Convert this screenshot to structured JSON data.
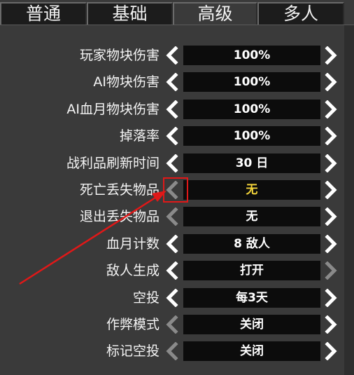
{
  "tabs": [
    {
      "label": "普通",
      "active": false
    },
    {
      "label": "基础",
      "active": false
    },
    {
      "label": "高级",
      "active": true
    },
    {
      "label": "多人",
      "active": false
    }
  ],
  "settings": [
    {
      "label": "玩家物块伤害",
      "value": "100%",
      "left_enabled": true,
      "right_enabled": true
    },
    {
      "label": "AI物块伤害",
      "value": "100%",
      "left_enabled": true,
      "right_enabled": true
    },
    {
      "label": "AI血月物块伤害",
      "value": "100%",
      "left_enabled": true,
      "right_enabled": true
    },
    {
      "label": "掉落率",
      "value": "100%",
      "left_enabled": true,
      "right_enabled": true
    },
    {
      "label": "战利品刷新时间",
      "value": "30 日",
      "left_enabled": true,
      "right_enabled": true
    },
    {
      "label": "死亡丢失物品",
      "value": "无",
      "left_enabled": false,
      "right_enabled": true,
      "highlighted": true
    },
    {
      "label": "退出丢失物品",
      "value": "无",
      "left_enabled": false,
      "right_enabled": true
    },
    {
      "label": "血月计数",
      "value": "8 敌人",
      "left_enabled": true,
      "right_enabled": true
    },
    {
      "label": "敌人生成",
      "value": "打开",
      "left_enabled": true,
      "right_enabled": false
    },
    {
      "label": "空投",
      "value": "每3天",
      "left_enabled": true,
      "right_enabled": true
    },
    {
      "label": "作弊模式",
      "value": "关闭",
      "left_enabled": false,
      "right_enabled": true
    },
    {
      "label": "标记空投",
      "value": "关闭",
      "left_enabled": false,
      "right_enabled": true
    }
  ],
  "colors": {
    "highlight_value": "#f2d33a",
    "annotation": "#e01818",
    "arrow_enabled": "#ffffff",
    "arrow_disabled": "#8a8a8a"
  },
  "icons": {
    "left": "chevron-left-icon",
    "right": "chevron-right-icon"
  }
}
